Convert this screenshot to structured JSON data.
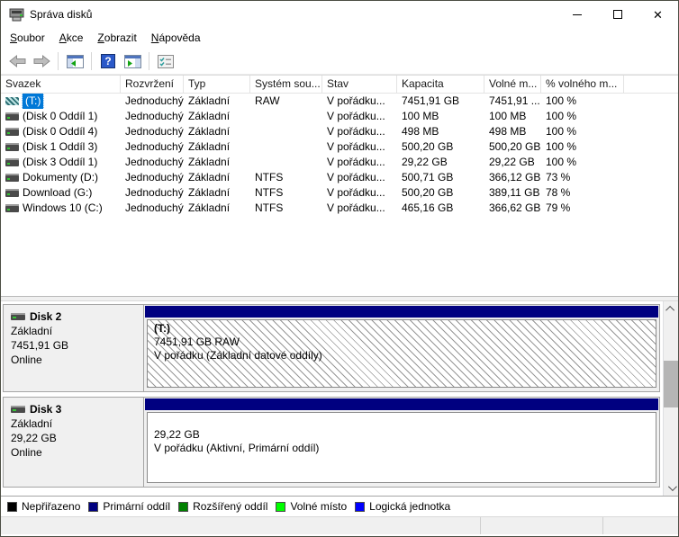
{
  "window": {
    "title": "Správa disků"
  },
  "menu": {
    "items": [
      {
        "key": "S",
        "rest": "oubor"
      },
      {
        "key": "A",
        "rest": "kce"
      },
      {
        "key": "Z",
        "rest": "obrazit"
      },
      {
        "key": "N",
        "rest": "ápověda"
      }
    ]
  },
  "toolbar": {
    "icons": [
      "back-arrow",
      "forward-arrow",
      "show-console-tree",
      "help",
      "show-action-pane",
      "customize-view"
    ]
  },
  "table": {
    "columns": [
      "Svazek",
      "Rozvržení",
      "Typ",
      "Systém sou...",
      "Stav",
      "Kapacita",
      "Volné m...",
      "% volného m..."
    ],
    "rows": [
      {
        "volume": "(T:)",
        "layout": "Jednoduchý",
        "type": "Základní",
        "fs": "RAW",
        "status": "V pořádku...",
        "capacity": "7451,91 GB",
        "free": "7451,91 ...",
        "pct": "100 %",
        "selected": true
      },
      {
        "volume": "(Disk 0 Oddíl 1)",
        "layout": "Jednoduchý",
        "type": "Základní",
        "fs": "",
        "status": "V pořádku...",
        "capacity": "100 MB",
        "free": "100 MB",
        "pct": "100 %",
        "selected": false
      },
      {
        "volume": "(Disk 0 Oddíl 4)",
        "layout": "Jednoduchý",
        "type": "Základní",
        "fs": "",
        "status": "V pořádku...",
        "capacity": "498 MB",
        "free": "498 MB",
        "pct": "100 %",
        "selected": false
      },
      {
        "volume": "(Disk 1 Oddíl 3)",
        "layout": "Jednoduchý",
        "type": "Základní",
        "fs": "",
        "status": "V pořádku...",
        "capacity": "500,20 GB",
        "free": "500,20 GB",
        "pct": "100 %",
        "selected": false
      },
      {
        "volume": "(Disk 3 Oddíl 1)",
        "layout": "Jednoduchý",
        "type": "Základní",
        "fs": "",
        "status": "V pořádku...",
        "capacity": "29,22 GB",
        "free": "29,22 GB",
        "pct": "100 %",
        "selected": false
      },
      {
        "volume": "Dokumenty (D:)",
        "layout": "Jednoduchý",
        "type": "Základní",
        "fs": "NTFS",
        "status": "V pořádku...",
        "capacity": "500,71 GB",
        "free": "366,12 GB",
        "pct": "73 %",
        "selected": false
      },
      {
        "volume": "Download (G:)",
        "layout": "Jednoduchý",
        "type": "Základní",
        "fs": "NTFS",
        "status": "V pořádku...",
        "capacity": "500,20 GB",
        "free": "389,11 GB",
        "pct": "78 %",
        "selected": false
      },
      {
        "volume": "Windows 10 (C:)",
        "layout": "Jednoduchý",
        "type": "Základní",
        "fs": "NTFS",
        "status": "V pořádku...",
        "capacity": "465,16 GB",
        "free": "366,62 GB",
        "pct": "79 %",
        "selected": false
      }
    ]
  },
  "disks": [
    {
      "name": "Disk 2",
      "kind": "Základní",
      "size": "7451,91 GB",
      "status": "Online",
      "partition": {
        "title": "(T:)",
        "size_fs": "7451,91 GB RAW",
        "status": "V pořádku (Základní datové oddíly)",
        "selected": true
      }
    },
    {
      "name": "Disk 3",
      "kind": "Základní",
      "size": "29,22 GB",
      "status": "Online",
      "partition": {
        "title": "",
        "size_fs": "29,22 GB",
        "status": "V pořádku (Aktivní, Primární oddíl)",
        "selected": false
      }
    }
  ],
  "legend": {
    "items": [
      {
        "label": "Nepřiřazeno",
        "color": "#000000"
      },
      {
        "label": "Primární oddíl",
        "color": "#000080"
      },
      {
        "label": "Rozšířený oddíl",
        "color": "#008000"
      },
      {
        "label": "Volné místo",
        "color": "#00ff00"
      },
      {
        "label": "Logická jednotka",
        "color": "#0000ff"
      }
    ]
  },
  "colors": {
    "selection": "#0078d7",
    "primary_partition": "#000080"
  }
}
